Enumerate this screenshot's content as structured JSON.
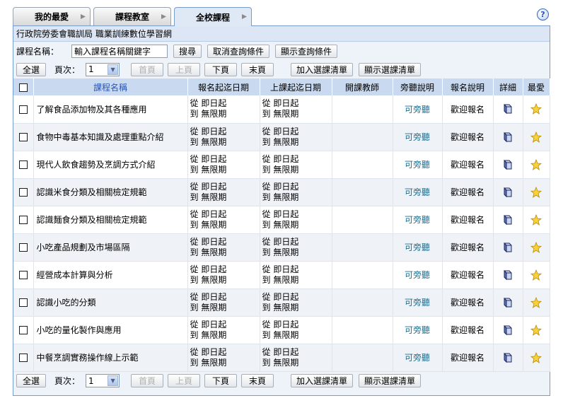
{
  "tabs": [
    {
      "label": "我的最愛"
    },
    {
      "label": "課程教室"
    },
    {
      "label": "全校課程",
      "active": true
    }
  ],
  "help": {
    "label": "?"
  },
  "title": "行政院勞委會職訓局 職業訓練數位學習網",
  "search": {
    "label": "課程名稱：",
    "value": "輸入課程名稱關鍵字",
    "search_btn": "搜尋",
    "cancel_btn": "取消查詢條件",
    "show_btn": "顯示查詢條件"
  },
  "pager": {
    "select_all": "全選",
    "page_label": "頁次：",
    "page_value": "1",
    "first": "首頁",
    "prev": "上頁",
    "next": "下頁",
    "last": "末頁",
    "add_list": "加入選課清單",
    "show_list": "顯示選課清單"
  },
  "columns": {
    "name": "課程名稱",
    "signup_period": "報名起迄日期",
    "class_period": "上課起迄日期",
    "teacher": "開課教師",
    "audit": "旁聽說明",
    "signup_note": "報名說明",
    "detail": "詳細",
    "favorite": "最愛"
  },
  "rows": [
    {
      "name": "了解食品添加物及其各種應用",
      "s1": "從 即日起",
      "s2": "到 無限期",
      "c1": "從 即日起",
      "c2": "到 無限期",
      "teacher": "",
      "audit": "可旁聽",
      "signup": "歡迎報名"
    },
    {
      "name": "食物中毒基本知識及處理重點介紹",
      "s1": "從 即日起",
      "s2": "到 無限期",
      "c1": "從 即日起",
      "c2": "到 無限期",
      "teacher": "",
      "audit": "可旁聽",
      "signup": "歡迎報名"
    },
    {
      "name": "現代人飲食趨勢及烹調方式介紹",
      "s1": "從 即日起",
      "s2": "到 無限期",
      "c1": "從 即日起",
      "c2": "到 無限期",
      "teacher": "",
      "audit": "可旁聽",
      "signup": "歡迎報名"
    },
    {
      "name": "認識米食分類及相關檢定規範",
      "s1": "從 即日起",
      "s2": "到 無限期",
      "c1": "從 即日起",
      "c2": "到 無限期",
      "teacher": "",
      "audit": "可旁聽",
      "signup": "歡迎報名"
    },
    {
      "name": "認識麵食分類及相關檢定規範",
      "s1": "從 即日起",
      "s2": "到 無限期",
      "c1": "從 即日起",
      "c2": "到 無限期",
      "teacher": "",
      "audit": "可旁聽",
      "signup": "歡迎報名"
    },
    {
      "name": "小吃產品規劃及市場區隔",
      "s1": "從 即日起",
      "s2": "到 無限期",
      "c1": "從 即日起",
      "c2": "到 無限期",
      "teacher": "",
      "audit": "可旁聽",
      "signup": "歡迎報名"
    },
    {
      "name": "經營成本計算與分析",
      "s1": "從 即日起",
      "s2": "到 無限期",
      "c1": "從 即日起",
      "c2": "到 無限期",
      "teacher": "",
      "audit": "可旁聽",
      "signup": "歡迎報名"
    },
    {
      "name": "認識小吃的分類",
      "s1": "從 即日起",
      "s2": "到 無限期",
      "c1": "從 即日起",
      "c2": "到 無限期",
      "teacher": "",
      "audit": "可旁聽",
      "signup": "歡迎報名"
    },
    {
      "name": "小吃的量化製作與應用",
      "s1": "從 即日起",
      "s2": "到 無限期",
      "c1": "從 即日起",
      "c2": "到 無限期",
      "teacher": "",
      "audit": "可旁聽",
      "signup": "歡迎報名"
    },
    {
      "name": "中餐烹調實務操作線上示範",
      "s1": "從 即日起",
      "s2": "到 無限期",
      "c1": "從 即日起",
      "c2": "到 無限期",
      "teacher": "",
      "audit": "可旁聽",
      "signup": "歡迎報名"
    }
  ],
  "icons": {
    "detail": "book-icon",
    "favorite": "star-icon"
  },
  "colors": {
    "header_bg": "#c9d9ef",
    "panel_border": "#7a9cc8",
    "audit_text": "#1e6e8e",
    "name_header": "#2a56b0"
  }
}
